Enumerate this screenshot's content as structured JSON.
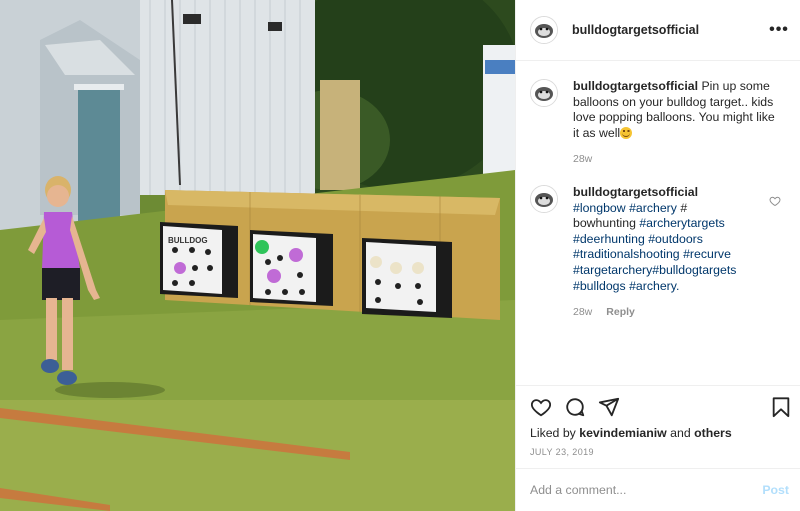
{
  "post": {
    "username": "bulldogtargetsofficial",
    "more_icon": "more-options-icon"
  },
  "comments": [
    {
      "username": "bulldogtargetsofficial",
      "text": "Pin up some balloons on your bulldog target.. kids love popping balloons. You might like it as well",
      "time": "28w"
    },
    {
      "username": "bulldogtargetsofficial",
      "tags": [
        "#longbow",
        "#archery"
      ],
      "plain": "# bowhunting",
      "tags2": [
        "#archerytargets",
        "#deerhunting",
        "#outdoors",
        "#traditionalshooting",
        "#recurve",
        "#targetarchery#bulldogtargets",
        "#bulldogs",
        "#archery"
      ],
      "time": "28w",
      "reply_label": "Reply"
    }
  ],
  "actions": {
    "icons": [
      "heart-icon",
      "comment-icon",
      "share-icon",
      "bookmark-icon"
    ]
  },
  "likes": {
    "prefix": "Liked by",
    "user": "kevindemianiw",
    "and": "and",
    "others": "others"
  },
  "date": "July 23, 2019",
  "add_comment": {
    "placeholder": "Add a comment...",
    "post_label": "Post"
  },
  "colors": {
    "link": "#00376b",
    "secondary": "#8e8e8e",
    "post_disabled": "#b2dffc"
  }
}
